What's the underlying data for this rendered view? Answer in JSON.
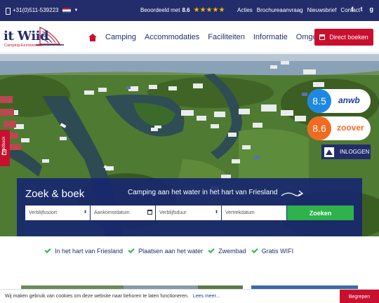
{
  "topbar": {
    "phone": "+31(0)511-539223",
    "rating_prefix": "Beoordeeld met",
    "rating_value": "8.6",
    "stars": "★★★★★",
    "links": [
      "Acties",
      "Brochureaanvraag",
      "Nieuwsbrief",
      "Contact"
    ],
    "social": [
      "f",
      "t",
      "g"
    ]
  },
  "header": {
    "logo_word": "it Wiid",
    "logo_sub": "Camping-Eernewoude",
    "nav": [
      "Camping",
      "Accommodaties",
      "Faciliteiten",
      "Informatie",
      "Omgeving"
    ],
    "book_label": "Direct boeken"
  },
  "badges": {
    "anwb_score": "8.5",
    "anwb_brand": "anwb",
    "zoover_score": "8.6",
    "zoover_brand": "zoover",
    "login_label": "INLOGGEN"
  },
  "feedback_label": "Feedback",
  "search": {
    "title": "Zoek & boek",
    "tagline": "Camping aan het water in het hart van Friesland",
    "fields": [
      "Verblijfssoort",
      "Aankomstdatum",
      "Verblijfsduur",
      "Vertrekdatum"
    ],
    "button": "Zoeken"
  },
  "usps": [
    "In het hart van Friesland",
    "Plaatsen aan het water",
    "Zwembad",
    "Gratis WIFI"
  ],
  "cookie": {
    "message": "Wij maken gebruik van cookies om deze website naar behoren te laten functioneren.",
    "more": "Lees meer...",
    "accept": "Begrepen"
  },
  "colors": {
    "navy": "#232d6b",
    "red": "#c8102e",
    "green": "#2fb24c",
    "anwb_blue": "#1e88e5",
    "zoover_orange": "#f26a21"
  }
}
